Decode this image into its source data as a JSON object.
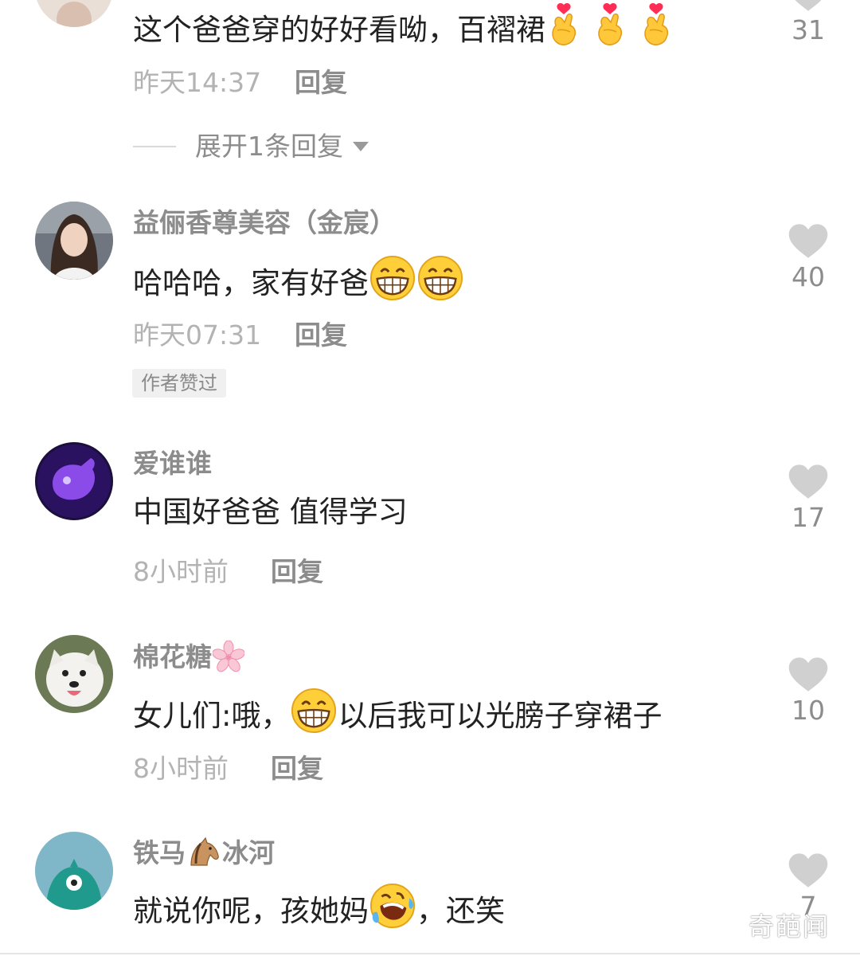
{
  "comments": [
    {
      "text": "这个爸爸穿的好好看呦，百褶裙",
      "time": "昨天14:37",
      "reply_label": "回复",
      "likes": "31",
      "expand_label": "展开1条回复"
    },
    {
      "username": "益俪香尊美容（金宸）",
      "text": "哈哈哈，家有好爸",
      "time": "昨天07:31",
      "reply_label": "回复",
      "likes": "40",
      "badge": "作者赞过"
    },
    {
      "username": "爱谁谁",
      "text": "中国好爸爸 值得学习",
      "time": "8小时前",
      "reply_label": "回复",
      "likes": "17"
    },
    {
      "username": "棉花糖",
      "text_before": "女儿们:哦，",
      "text_after": "以后我可以光膀子穿裙子",
      "time": "8小时前",
      "reply_label": "回复",
      "likes": "10"
    },
    {
      "username_before": "铁马",
      "username_after": "冰河",
      "text_before": "就说你呢，孩她妈",
      "text_after": "，还笑",
      "likes": "7"
    }
  ],
  "watermark": "奇葩闻",
  "colors": {
    "username": "#8c8c8c",
    "comment_text": "#222222",
    "meta": "#b3b3b3",
    "heart": "#d0d0d0",
    "badge_bg": "#f0f0f0"
  },
  "icons": [
    "heart-icon",
    "caret-down-icon",
    "finger-heart-emoji",
    "grin-emoji",
    "sakura-emoji",
    "horse-emoji",
    "rofl-emoji"
  ]
}
